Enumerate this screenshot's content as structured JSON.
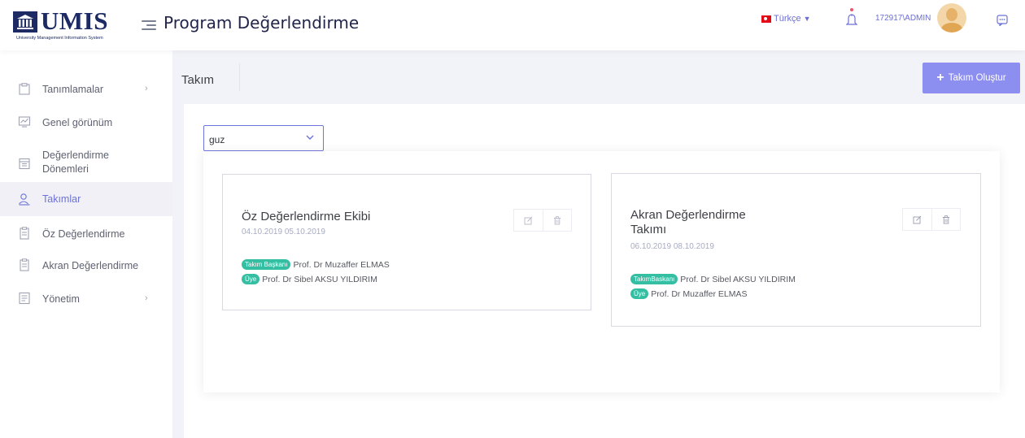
{
  "header": {
    "logo_text": "UMIS",
    "logo_subtitle": "University Management Information System",
    "app_title": "Program Değerlendirme",
    "language": "Türkçe",
    "user": "172917\\ADMIN"
  },
  "sidebar": {
    "items": [
      {
        "label": "Tanımlamalar",
        "icon": "folder-icon",
        "has_arrow": true
      },
      {
        "label": "Genel görünüm",
        "icon": "chart-icon",
        "has_arrow": false
      },
      {
        "label": "Değerlendirme Dönemleri",
        "icon": "calendar-icon",
        "has_arrow": false
      },
      {
        "label": "Takımlar",
        "icon": "team-icon",
        "has_arrow": false,
        "active": true
      },
      {
        "label": "Öz Değerlendirme",
        "icon": "clipboard-icon",
        "has_arrow": false
      },
      {
        "label": "Akran Değerlendirme",
        "icon": "clipboard-icon",
        "has_arrow": false
      },
      {
        "label": "Yönetim",
        "icon": "settings-panel-icon",
        "has_arrow": true
      }
    ]
  },
  "page": {
    "title": "Takım",
    "create_button": "Takım Oluştur"
  },
  "filter": {
    "selected": "guz"
  },
  "teams": [
    {
      "title": "Öz Değerlendirme Ekibi",
      "dates": "04.10.2019 05.10.2019",
      "members": [
        {
          "role": "Takım Başkanı",
          "name": "Prof. Dr Muzaffer ELMAS"
        },
        {
          "role": "Üye",
          "name": "Prof. Dr Sibel AKSU YILDIRIM"
        }
      ]
    },
    {
      "title_line1": "Akran Değerlendirme",
      "title_line2": "Takımı",
      "dates": "06.10.2019 08.10.2019",
      "members": [
        {
          "role": "TakımBaskanı",
          "name": "Prof. Dr Sibel AKSU YILDIRIM"
        },
        {
          "role": "Üye",
          "name": "Prof. Dr Muzaffer ELMAS"
        }
      ]
    }
  ],
  "colors": {
    "accent": "#6c72d8",
    "button": "#8d8ff0",
    "badge": "#34bfa3",
    "logo": "#1d2a63"
  }
}
